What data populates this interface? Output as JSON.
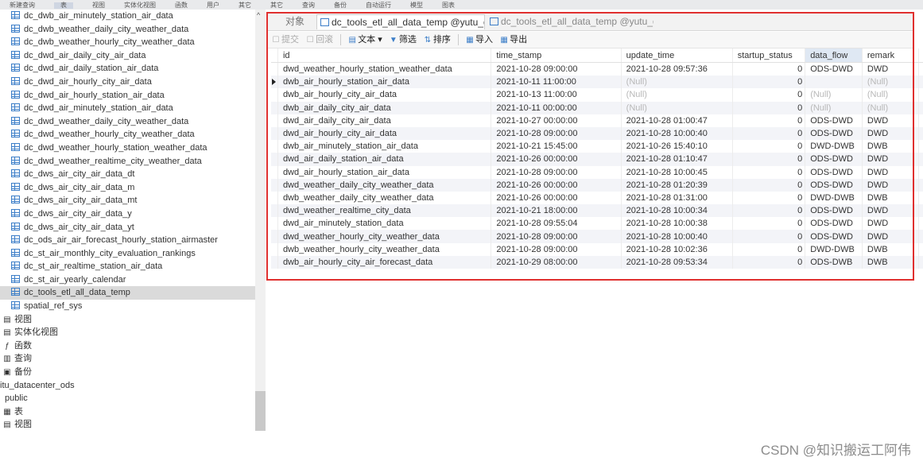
{
  "menubar": {
    "items": [
      "新建查询",
      "表",
      "视图",
      "实体化视图",
      "函数",
      "用户",
      "其它",
      "其它",
      "查询",
      "备份",
      "自动运行",
      "模型",
      "图表"
    ],
    "active_index": 1
  },
  "sidebar": {
    "tables": [
      "dc_dwb_air_minutely_station_air_data",
      "dc_dwb_weather_daily_city_weather_data",
      "dc_dwb_weather_hourly_city_weather_data",
      "dc_dwd_air_daily_city_air_data",
      "dc_dwd_air_daily_station_air_data",
      "dc_dwd_air_hourly_city_air_data",
      "dc_dwd_air_hourly_station_air_data",
      "dc_dwd_air_minutely_station_air_data",
      "dc_dwd_weather_daily_city_weather_data",
      "dc_dwd_weather_hourly_city_weather_data",
      "dc_dwd_weather_hourly_station_weather_data",
      "dc_dwd_weather_realtime_city_weather_data",
      "dc_dws_air_city_air_data_dt",
      "dc_dws_air_city_air_data_m",
      "dc_dws_air_city_air_data_mt",
      "dc_dws_air_city_air_data_y",
      "dc_dws_air_city_air_data_yt",
      "dc_ods_air_air_forecast_hourly_station_airmaster",
      "dc_st_air_monthly_city_evaluation_rankings",
      "dc_st_air_realtime_station_air_data",
      "dc_st_air_yearly_calendar",
      "dc_tools_etl_all_data_temp",
      "spatial_ref_sys"
    ],
    "selected_index": 21,
    "categories": {
      "views": "视图",
      "materialized_views": "实体化视图",
      "functions": "函数",
      "queries": "查询",
      "backups": "备份"
    },
    "db2": "itu_datacenter_ods",
    "schema2": "public",
    "schema2_tables": "表",
    "schema2_views": "视图"
  },
  "tabs": {
    "objects": "对象",
    "tab1": "dc_tools_etl_all_data_temp @yutu_d...",
    "tab2": "dc_tools_etl_all_data_temp @yutu_d..."
  },
  "toolbar": {
    "submit": "提交",
    "rollback": "回滚",
    "text": "文本",
    "filter": "筛选",
    "sort": "排序",
    "import": "导入",
    "export": "导出"
  },
  "grid": {
    "columns": [
      "id",
      "time_stamp",
      "update_time",
      "startup_status",
      "data_flow",
      "remark"
    ],
    "highlighted_column": "data_flow",
    "current_row": 1,
    "rows": [
      [
        "dwd_weather_hourly_station_weather_data",
        "2021-10-28 09:00:00",
        "2021-10-28 09:57:36",
        "0",
        "ODS-DWD",
        "DWD"
      ],
      [
        "dwb_air_hourly_station_air_data",
        "2021-10-11 11:00:00",
        "(Null)",
        "0",
        "",
        "(Null)"
      ],
      [
        "dwb_air_hourly_city_air_data",
        "2021-10-13 11:00:00",
        "(Null)",
        "0",
        "(Null)",
        "(Null)"
      ],
      [
        "dwb_air_daily_city_air_data",
        "2021-10-11 00:00:00",
        "(Null)",
        "0",
        "(Null)",
        "(Null)"
      ],
      [
        "dwd_air_daily_city_air_data",
        "2021-10-27 00:00:00",
        "2021-10-28 01:00:47",
        "0",
        "ODS-DWD",
        "DWD"
      ],
      [
        "dwd_air_hourly_city_air_data",
        "2021-10-28 09:00:00",
        "2021-10-28 10:00:40",
        "0",
        "ODS-DWD",
        "DWD"
      ],
      [
        "dwb_air_minutely_station_air_data",
        "2021-10-21 15:45:00",
        "2021-10-26 15:40:10",
        "0",
        "DWD-DWB",
        "DWB"
      ],
      [
        "dwd_air_daily_station_air_data",
        "2021-10-26 00:00:00",
        "2021-10-28 01:10:47",
        "0",
        "ODS-DWD",
        "DWD"
      ],
      [
        "dwd_air_hourly_station_air_data",
        "2021-10-28 09:00:00",
        "2021-10-28 10:00:45",
        "0",
        "ODS-DWD",
        "DWD"
      ],
      [
        "dwd_weather_daily_city_weather_data",
        "2021-10-26 00:00:00",
        "2021-10-28 01:20:39",
        "0",
        "ODS-DWD",
        "DWD"
      ],
      [
        "dwb_weather_daily_city_weather_data",
        "2021-10-26 00:00:00",
        "2021-10-28 01:31:00",
        "0",
        "DWD-DWB",
        "DWB"
      ],
      [
        "dwd_weather_realtime_city_data",
        "2021-10-21 18:00:00",
        "2021-10-28 10:00:34",
        "0",
        "ODS-DWD",
        "DWD"
      ],
      [
        "dwd_air_minutely_station_data",
        "2021-10-28 09:55:04",
        "2021-10-28 10:00:38",
        "0",
        "ODS-DWD",
        "DWD"
      ],
      [
        "dwd_weather_hourly_city_weather_data",
        "2021-10-28 09:00:00",
        "2021-10-28 10:00:40",
        "0",
        "ODS-DWD",
        "DWD"
      ],
      [
        "dwb_weather_hourly_city_weather_data",
        "2021-10-28 09:00:00",
        "2021-10-28 10:02:36",
        "0",
        "DWD-DWB",
        "DWB"
      ],
      [
        "dwb_air_hourly_city_air_forecast_data",
        "2021-10-29 08:00:00",
        "2021-10-28 09:53:34",
        "0",
        "ODS-DWB",
        "DWB"
      ]
    ]
  },
  "watermark": "CSDN @知识搬运工阿伟",
  "colors": {
    "highlight_border": "#e0302f",
    "selection": "#dadada",
    "null_text": "#b8b8b8"
  }
}
